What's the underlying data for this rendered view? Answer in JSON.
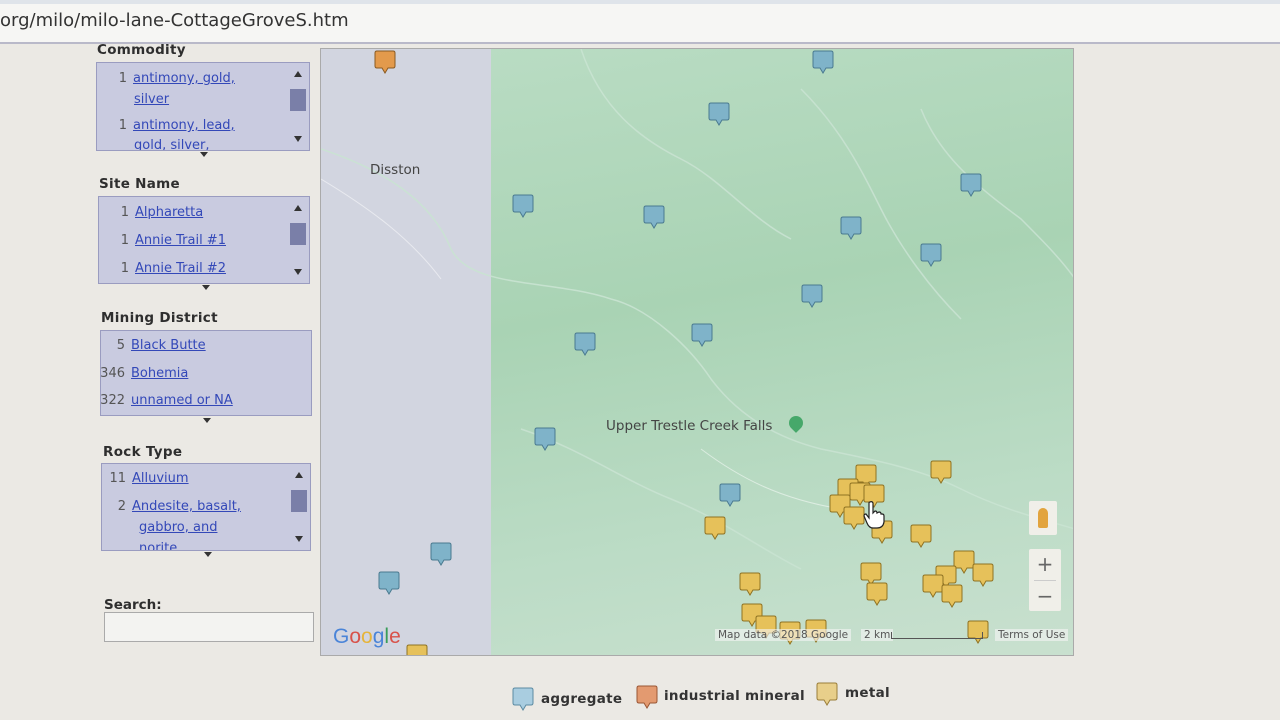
{
  "browser": {
    "url": "org/milo/milo-lane-CottageGroveS.htm"
  },
  "filters": {
    "commodity": {
      "title": "Commodity",
      "items": [
        {
          "count": "1",
          "label_line1": "antimony, gold,",
          "label_line2": "silver"
        },
        {
          "count": "1",
          "label_line1": "antimony, lead,",
          "label_line2": "gold, silver,"
        }
      ]
    },
    "site_name": {
      "title": "Site Name",
      "items": [
        {
          "count": "1",
          "label": "Alpharetta"
        },
        {
          "count": "1",
          "label": "Annie Trail #1"
        },
        {
          "count": "1",
          "label": "Annie Trail #2"
        }
      ]
    },
    "mining_district": {
      "title": "Mining District",
      "items": [
        {
          "count": "5",
          "label": "Black Butte"
        },
        {
          "count": "346",
          "label": "Bohemia"
        },
        {
          "count": "322",
          "label": "unnamed or NA"
        }
      ]
    },
    "rock_type": {
      "title": "Rock Type",
      "items": [
        {
          "count": "11",
          "label": "Alluvium"
        },
        {
          "count": "2",
          "label_line1": "Andesite, basalt,",
          "label_line2": "gabbro, and",
          "label_line3": "norite"
        }
      ]
    }
  },
  "search": {
    "label": "Search:",
    "value": ""
  },
  "map": {
    "places": {
      "disston": "Disston",
      "falls": "Upper Trestle Creek Falls"
    },
    "attribution": "Map data ©2018 Google",
    "scale": "2 km",
    "terms": "Terms of Use",
    "logo": [
      "G",
      "o",
      "o",
      "g",
      "l",
      "e"
    ],
    "zoom_in": "+",
    "zoom_out": "−",
    "marker_colors": {
      "aggregate": "#7fb3c9",
      "industrial": "#e39a4c",
      "metal": "#e6c15a"
    }
  },
  "legend": {
    "aggregate": "aggregate",
    "industrial": "industrial mineral",
    "metal": "metal"
  }
}
